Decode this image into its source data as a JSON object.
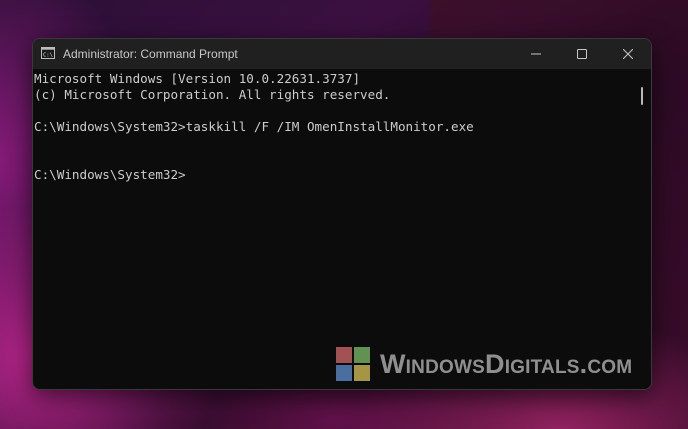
{
  "window": {
    "title": "Administrator: Command Prompt",
    "controls": [
      "minimize",
      "maximize",
      "close"
    ]
  },
  "console": {
    "lines": [
      "Microsoft Windows [Version 10.0.22631.3737]",
      "(c) Microsoft Corporation. All rights reserved.",
      "",
      "C:\\Windows\\System32>taskkill /F /IM OmenInstallMonitor.exe",
      "",
      "",
      "C:\\Windows\\System32>"
    ]
  },
  "watermark": {
    "text": "WindowsDigitals.com"
  },
  "colors": {
    "console_bg": "#0c0c0c",
    "console_text": "#cccccc",
    "titlebar_bg": "#202020"
  }
}
